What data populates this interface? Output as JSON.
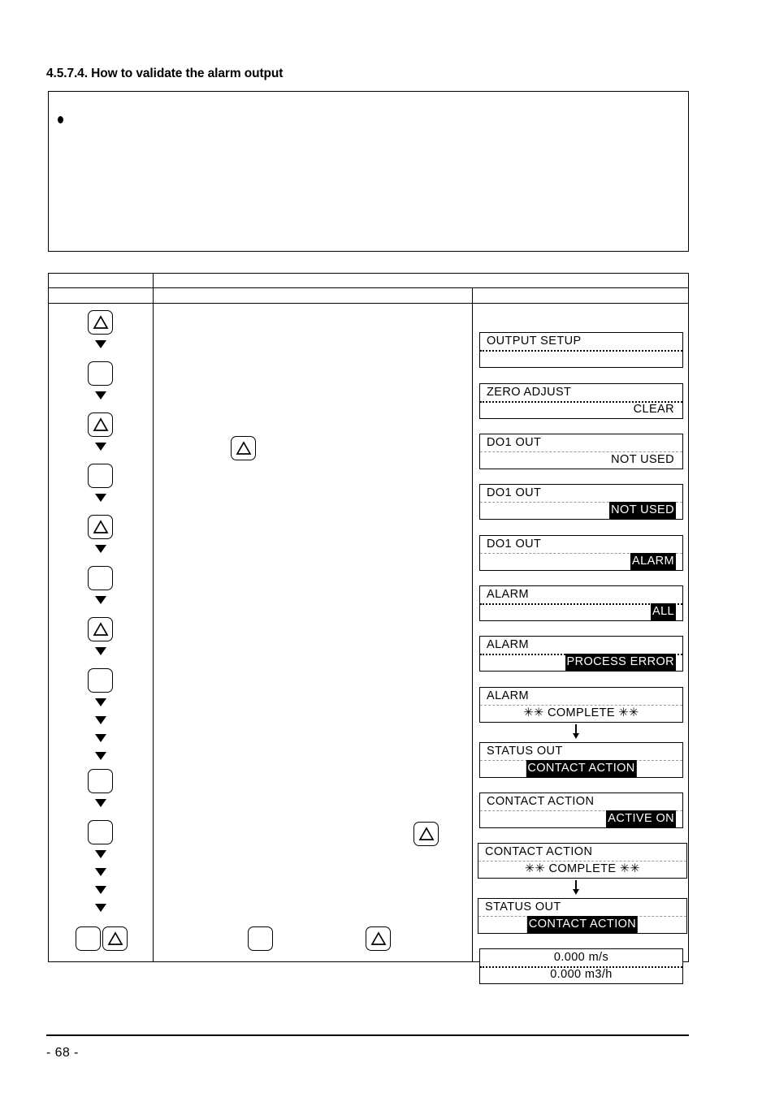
{
  "heading": "4.5.7.4. How to validate the alarm output",
  "note_box": {
    "bullet_icon": "bullet-point",
    "text": ""
  },
  "table": {
    "header_rows": [
      {
        "cells": [
          "",
          ""
        ]
      },
      {
        "cells": [
          "",
          "",
          ""
        ]
      }
    ],
    "columns": {
      "keys_label": "",
      "description_label": "",
      "display_label": ""
    }
  },
  "key_sequence": [
    {
      "type": "triangle-key",
      "icon": "triangle-up-icon",
      "label": "△"
    },
    {
      "type": "arrow",
      "icon": "arrow-down-icon"
    },
    {
      "type": "blank-key",
      "icon": "blank-key-icon",
      "label": ""
    },
    {
      "type": "arrow",
      "icon": "arrow-down-icon"
    },
    {
      "type": "triangle-key",
      "icon": "triangle-up-icon",
      "label": "△"
    },
    {
      "type": "arrow",
      "icon": "arrow-down-icon"
    },
    {
      "type": "blank-key",
      "icon": "blank-key-icon",
      "label": ""
    },
    {
      "type": "arrow",
      "icon": "arrow-down-icon"
    },
    {
      "type": "triangle-key",
      "icon": "triangle-up-icon",
      "label": "△"
    },
    {
      "type": "arrow",
      "icon": "arrow-down-icon"
    },
    {
      "type": "blank-key",
      "icon": "blank-key-icon",
      "label": ""
    },
    {
      "type": "arrow",
      "icon": "arrow-down-icon"
    },
    {
      "type": "triangle-key",
      "icon": "triangle-up-icon",
      "label": "△"
    },
    {
      "type": "arrow",
      "icon": "arrow-down-icon"
    },
    {
      "type": "blank-key",
      "icon": "blank-key-icon",
      "label": ""
    },
    {
      "type": "arrow",
      "icon": "arrow-down-icon"
    },
    {
      "type": "arrow",
      "icon": "arrow-down-icon"
    },
    {
      "type": "arrow",
      "icon": "arrow-down-icon"
    },
    {
      "type": "arrow",
      "icon": "arrow-down-icon"
    },
    {
      "type": "blank-key",
      "icon": "blank-key-icon",
      "label": ""
    },
    {
      "type": "arrow",
      "icon": "arrow-down-icon"
    },
    {
      "type": "blank-key",
      "icon": "blank-key-icon",
      "label": ""
    },
    {
      "type": "arrow",
      "icon": "arrow-down-icon"
    },
    {
      "type": "arrow",
      "icon": "arrow-down-icon"
    },
    {
      "type": "arrow",
      "icon": "arrow-down-icon"
    },
    {
      "type": "arrow",
      "icon": "arrow-down-icon"
    }
  ],
  "key_sequence_final_row": [
    {
      "type": "blank-key",
      "icon": "blank-key-icon",
      "label": ""
    },
    {
      "type": "triangle-key",
      "icon": "triangle-up-icon",
      "label": "△"
    }
  ],
  "description_keys": [
    {
      "type": "triangle-key",
      "icon": "triangle-up-icon",
      "label": "△"
    },
    {
      "type": "triangle-key",
      "icon": "triangle-up-icon",
      "label": "△"
    },
    {
      "type": "blank-key",
      "icon": "blank-key-icon",
      "label": ""
    },
    {
      "type": "triangle-key",
      "icon": "triangle-up-icon",
      "label": "△"
    }
  ],
  "displays": [
    {
      "name": "output-setup",
      "line1": "OUTPUT   SETUP",
      "line1_align": "left",
      "line1_inverted": false,
      "line2": "",
      "line2_align": "center",
      "line2_inverted": false,
      "separator": "bold"
    },
    {
      "name": "zero-adjust",
      "line1": "ZERO   ADJUST",
      "line1_align": "left",
      "line1_inverted": false,
      "line2": "CLEAR",
      "line2_align": "right",
      "line2_inverted": false,
      "separator": "bold"
    },
    {
      "name": "do1-out-not-used",
      "line1": "DO1   OUT",
      "line1_align": "left",
      "line1_inverted": false,
      "line2": "NOT   USED",
      "line2_align": "right",
      "line2_inverted": false,
      "separator": "light"
    },
    {
      "name": "do1-out-not-used-selected",
      "line1": "DO1   OUT",
      "line1_align": "left",
      "line1_inverted": false,
      "line2": "NOT   USED",
      "line2_align": "right",
      "line2_inverted": true,
      "separator": "light"
    },
    {
      "name": "do1-out-alarm-selected",
      "line1": "DO1   OUT",
      "line1_align": "left",
      "line1_inverted": false,
      "line2": "ALARM",
      "line2_align": "right",
      "line2_inverted": true,
      "separator": "light"
    },
    {
      "name": "alarm-all-selected",
      "line1": "ALARM",
      "line1_align": "left",
      "line1_inverted": false,
      "line2": "ALL",
      "line2_align": "right",
      "line2_inverted": true,
      "separator": "bold"
    },
    {
      "name": "alarm-process-error-selected",
      "line1": "ALARM",
      "line1_align": "left",
      "line1_inverted": false,
      "line2": "PROCESS   ERROR",
      "line2_align": "right",
      "line2_inverted": true,
      "separator": "bold"
    },
    {
      "name": "alarm-complete",
      "line1": "ALARM",
      "line1_align": "left",
      "line1_inverted": false,
      "line2": "✳✳   COMPLETE   ✳✳",
      "line2_align": "center",
      "line2_inverted": false,
      "separator": "light",
      "arrow_after": true
    },
    {
      "name": "status-out-contact-action-selected",
      "line1": "STATUS   OUT",
      "line1_align": "left",
      "line1_inverted": false,
      "line2": "CONTACT   ACTION",
      "line2_align": "center",
      "line2_inverted": true,
      "separator": "light"
    },
    {
      "name": "contact-action-active-on-selected",
      "line1": "CONTACT   ACTION",
      "line1_align": "left",
      "line1_inverted": false,
      "line2": "ACTIVE   ON",
      "line2_align": "right",
      "line2_inverted": true,
      "separator": "light"
    },
    {
      "name": "contact-action-complete",
      "line1": "CONTACT   ACTION",
      "line1_align": "left",
      "line1_inverted": false,
      "line2": "✳✳   COMPLETE   ✳✳",
      "line2_align": "center",
      "line2_inverted": false,
      "separator": "light",
      "arrow_after": true
    },
    {
      "name": "status-out-contact-action-selected-2",
      "line1": "STATUS   OUT",
      "line1_align": "left",
      "line1_inverted": false,
      "line2": "CONTACT   ACTION",
      "line2_align": "center",
      "line2_inverted": true,
      "separator": "light"
    },
    {
      "name": "measurement-readout",
      "line1": "0.000        m/s",
      "line1_align": "center",
      "line1_inverted": false,
      "line2": "0.000      m3/h",
      "line2_align": "center",
      "line2_inverted": false,
      "separator": "bold"
    }
  ],
  "footer": {
    "page_number": "- 68 -"
  }
}
